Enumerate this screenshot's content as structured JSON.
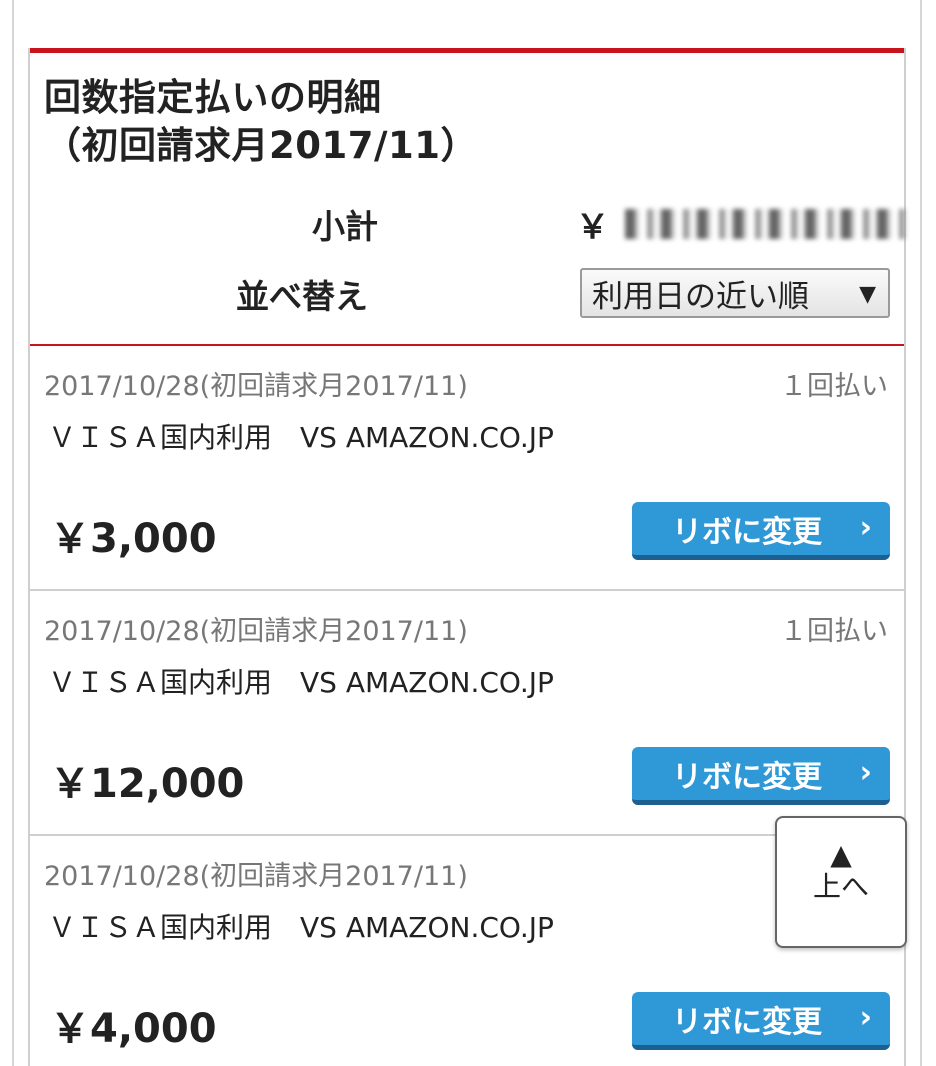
{
  "header": {
    "title_line1": "回数指定払いの明細",
    "title_line2": "（初回請求月2017/11）",
    "subtotal_label": "小計",
    "subtotal_currency": "￥",
    "sort_label": "並べ替え",
    "sort_selected": "利用日の近い順",
    "sort_arrow": "▼"
  },
  "items": [
    {
      "date": "2017/10/28(初回請求月2017/11)",
      "pay_count": "１回払い",
      "merchant": "ＶＩＳＡ国内利用　VS AMAZON.CO.JP",
      "amount": "￥3,000",
      "button_label": "リボに変更",
      "button_chevron": "›"
    },
    {
      "date": "2017/10/28(初回請求月2017/11)",
      "pay_count": "１回払い",
      "merchant": "ＶＩＳＡ国内利用　VS AMAZON.CO.JP",
      "amount": "￥12,000",
      "button_label": "リボに変更",
      "button_chevron": "›"
    },
    {
      "date": "2017/10/28(初回請求月2017/11)",
      "pay_count": "",
      "merchant": "ＶＩＳＡ国内利用　VS AMAZON.CO.JP",
      "amount": "￥4,000",
      "button_label": "リボに変更",
      "button_chevron": "›"
    }
  ],
  "back_to_top": {
    "icon": "▲",
    "label": "上へ"
  },
  "colors": {
    "accent_red": "#c8151d",
    "button_blue": "#2f98d7"
  }
}
